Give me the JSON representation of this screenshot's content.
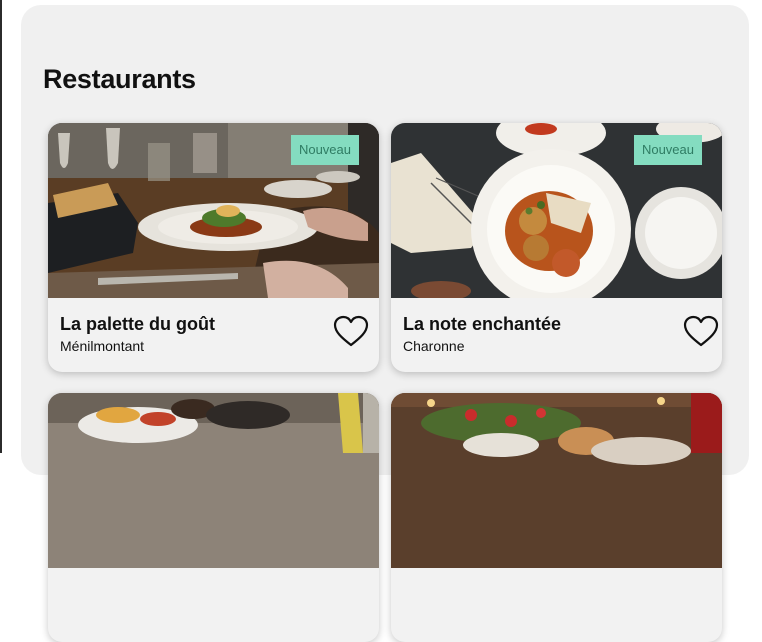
{
  "page": {
    "title": "Restaurants"
  },
  "restaurants": [
    {
      "name": "La palette du goût",
      "neighborhood": "Ménilmontant",
      "badge": "Nouveau",
      "favorite_icon": "heart-outline-icon"
    },
    {
      "name": "La note enchantée",
      "neighborhood": "Charonne",
      "badge": "Nouveau",
      "favorite_icon": "heart-outline-icon"
    }
  ]
}
